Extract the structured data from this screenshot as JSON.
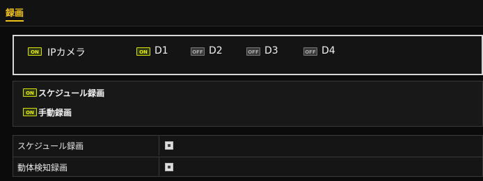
{
  "header": {
    "tab_label": "録画"
  },
  "camera_panel": {
    "ip_camera": {
      "toggle": "ON",
      "label": "IPカメラ"
    },
    "channels": [
      {
        "toggle": "ON",
        "label": "D1"
      },
      {
        "toggle": "OFF",
        "label": "D2"
      },
      {
        "toggle": "OFF",
        "label": "D3"
      },
      {
        "toggle": "OFF",
        "label": "D4"
      }
    ]
  },
  "recording_modes": [
    {
      "toggle": "ON",
      "label": "スケジュール録画"
    },
    {
      "toggle": "ON",
      "label": "手動録画"
    }
  ],
  "settings_table": [
    {
      "label": "スケジュール録画"
    },
    {
      "label": "動体検知録画"
    }
  ],
  "colors": {
    "accent": "#f0c21a",
    "on_green": "#e9f000",
    "background": "#0b0b0b"
  }
}
